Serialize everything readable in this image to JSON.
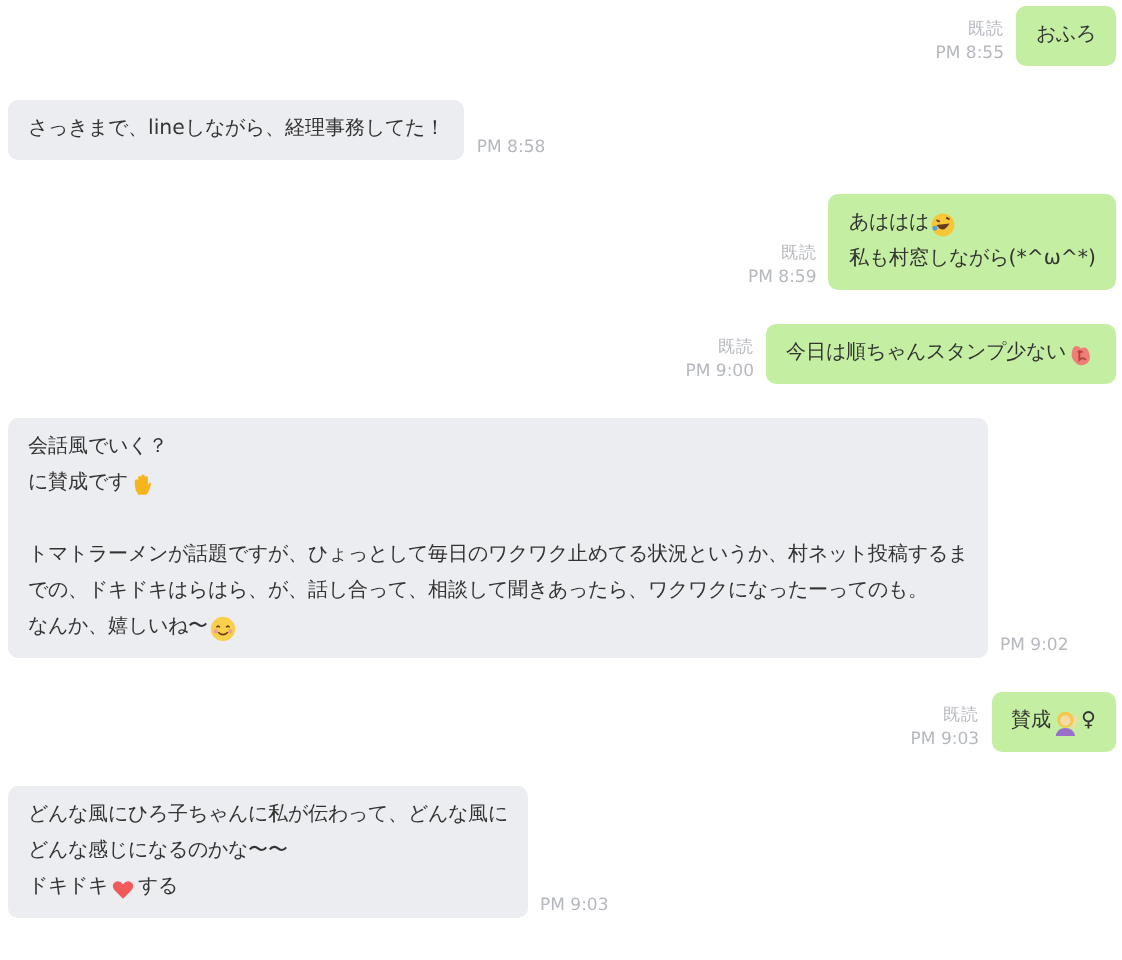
{
  "messages": [
    {
      "kind": "sent",
      "read": "既読",
      "time": "PM 8:55",
      "paragraphs": [
        [
          [
            {
              "kind": "text",
              "text": "おふろ"
            }
          ]
        ]
      ]
    },
    {
      "kind": "received",
      "time": "PM 8:58",
      "paragraphs": [
        [
          [
            {
              "kind": "text",
              "text": "さっきまで、lineしながら、経理事務してた！"
            }
          ]
        ]
      ]
    },
    {
      "kind": "sent",
      "read": "既読",
      "time": "PM 8:59",
      "paragraphs": [
        [
          [
            {
              "kind": "text",
              "text": "あははは"
            },
            {
              "kind": "laugh"
            }
          ],
          [
            {
              "kind": "text",
              "text": "私も村窓しながら(*^ω^*)"
            }
          ]
        ]
      ]
    },
    {
      "kind": "sent",
      "read": "既読",
      "time": "PM 9:00",
      "paragraphs": [
        [
          [
            {
              "kind": "text",
              "text": "今日は順ちゃんスタンプ少ない"
            },
            {
              "kind": "stamp"
            }
          ]
        ]
      ]
    },
    {
      "kind": "received",
      "time": "PM 9:02",
      "paragraphs": [
        [
          [
            {
              "kind": "text",
              "text": "会話風でいく？"
            }
          ],
          [
            {
              "kind": "text",
              "text": "に賛成です"
            },
            {
              "kind": "hand"
            }
          ]
        ],
        [
          [
            {
              "kind": "text",
              "text": "トマトラーメンが話題ですが、ひょっとして毎日のワクワク止めてる状況というか、村ネット投稿するま"
            }
          ],
          [
            {
              "kind": "text",
              "text": "での、ドキドキはらはら、が、話し合って、相談して聞きあったら、ワクワクになったーってのも。"
            }
          ],
          [
            {
              "kind": "text",
              "text": "なんか、嬉しいね〜"
            },
            {
              "kind": "smile"
            }
          ]
        ]
      ]
    },
    {
      "kind": "sent",
      "read": "既読",
      "time": "PM 9:03",
      "paragraphs": [
        [
          [
            {
              "kind": "text",
              "text": "賛成"
            },
            {
              "kind": "person"
            },
            {
              "kind": "text",
              "text": "♀"
            }
          ]
        ]
      ]
    },
    {
      "kind": "received",
      "time": "PM 9:03",
      "paragraphs": [
        [
          [
            {
              "kind": "text",
              "text": "どんな風にひろ子ちゃんに私が伝わって、どんな風に"
            }
          ],
          [
            {
              "kind": "text",
              "text": "どんな感じになるのかな〜〜"
            }
          ],
          [
            {
              "kind": "text",
              "text": "ドキドキ"
            },
            {
              "kind": "heart"
            },
            {
              "kind": "text",
              "text": "する"
            }
          ]
        ]
      ]
    }
  ]
}
